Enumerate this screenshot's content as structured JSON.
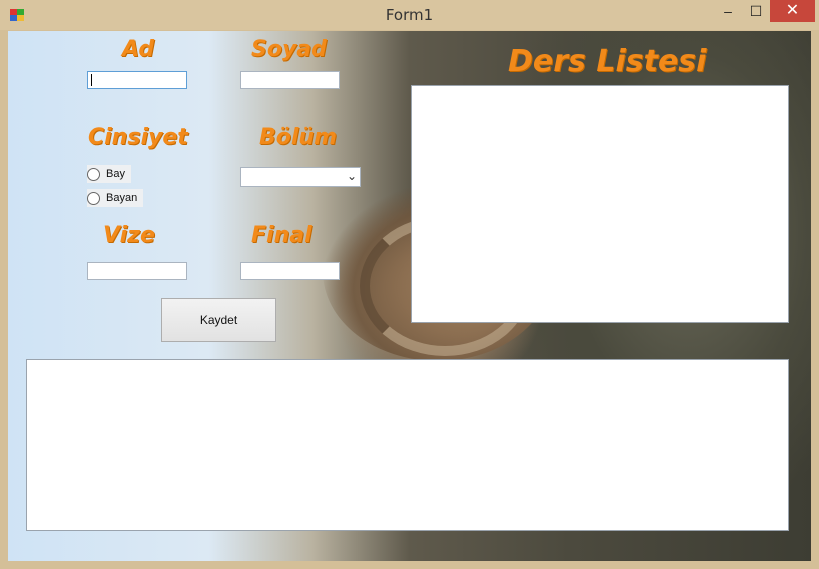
{
  "window": {
    "title": "Form1"
  },
  "controls": {
    "minimize": "–",
    "maximize": "☐",
    "close": "✕"
  },
  "labels": {
    "ad": "Ad",
    "soyad": "Soyad",
    "cinsiyet": "Cinsiyet",
    "bolum": "Bölüm",
    "vize": "Vize",
    "final": "Final",
    "ders_listesi": "Ders Listesi"
  },
  "inputs": {
    "ad": "",
    "soyad": "",
    "vize": "",
    "final": "",
    "bolum_selected": ""
  },
  "radios": {
    "bay": "Bay",
    "bayan": "Bayan"
  },
  "buttons": {
    "kaydet": "Kaydet"
  },
  "icons": {
    "app": "winforms-app-icon",
    "combo_arrow": "chevron-down-icon"
  }
}
